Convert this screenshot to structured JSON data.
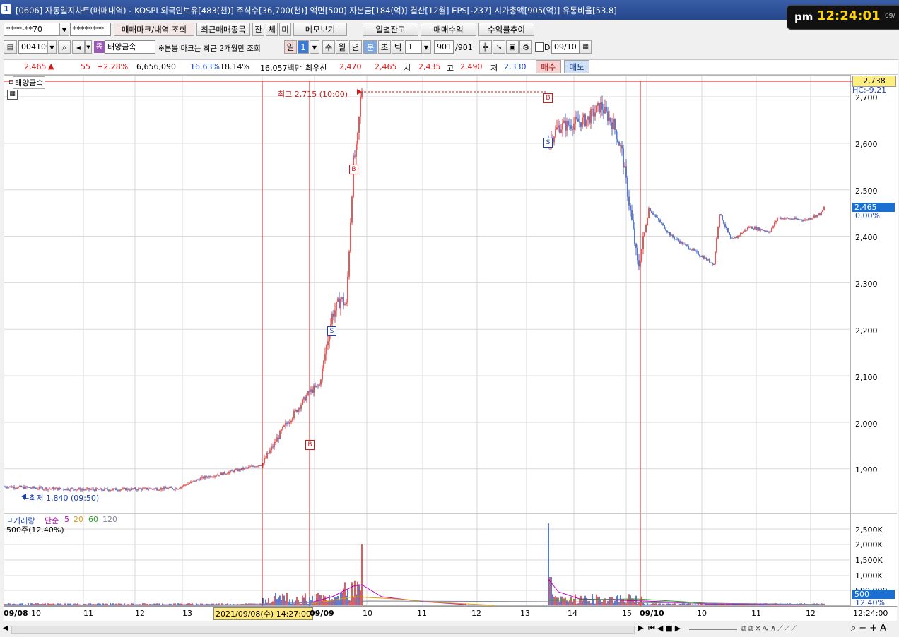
{
  "window": {
    "num": "1",
    "title": "[0606] 자동일지차트(매매내역) - KOSPI 외국인보유[483(천)] 주식수[36,700(천)] 액면[500] 자본금[184(억)] 결산[12월] EPS[-237] 시가총액[905(억)] 유통비율[53.8]"
  },
  "clock": {
    "ampm": "pm",
    "time": "12:24:01",
    "date": "09/"
  },
  "toolbar1": {
    "account": "****-**70",
    "password": "********",
    "mark_btn": "매매마크/내역 조회",
    "recent_btn": "최근매매종목",
    "b_jan": "잔",
    "b_che": "체",
    "b_mi": "미",
    "memo_btn": "메모보기",
    "daily_btn": "일별잔고",
    "profit_btn": "매매수익",
    "rate_btn": "수익률추이"
  },
  "toolbar2": {
    "code": "004100",
    "name_badge": "종",
    "name": "태양금속",
    "note": "※분봉 마크는 최근 2개월만 조회",
    "periods": [
      "일",
      "주",
      "월",
      "년",
      "분",
      "초",
      "틱"
    ],
    "period_num": "1",
    "tick_num": "1",
    "count": "901",
    "count_total": "/901",
    "checkbox_d": "D",
    "date": "09/10"
  },
  "quote": {
    "price": "2,465",
    "arrow": "▲",
    "change": "55",
    "pct": "+2.28%",
    "volume": "6,656,090",
    "vol_pct": "16.63%",
    "turnover": "18.14%",
    "amount": "16,057백만",
    "best_label": "최우선",
    "ask": "2,470",
    "bid": "2,465",
    "open_label": "시",
    "open": "2,435",
    "high_label": "고",
    "high": "2,490",
    "low_label": "저",
    "low": "2,330",
    "buy_btn": "매수",
    "sell_btn": "매도"
  },
  "chart": {
    "name": "태양금속",
    "high_label": "최고 2,715 (10:00)",
    "low_label": "←최저 1,840 (09:50)",
    "price_axis": [
      "2,700",
      "2,600",
      "2,500",
      "2,400",
      "2,300",
      "2,200",
      "2,100",
      "2,000",
      "1,900"
    ],
    "top_tag": "2,738",
    "hc_tag": "HC:-9.21",
    "cur_tag": "2,465",
    "zero_tag": "0.00%",
    "vol_title": "거래량",
    "vol_ma_label": "단순",
    "vol_ma": [
      "5",
      "20",
      "60",
      "120"
    ],
    "vol_sub": "500주(12.40%)",
    "vol_axis": [
      "2,500K",
      "2,000K",
      "1,500K",
      "1,000K",
      "500,000"
    ],
    "vol_tag": "500",
    "vol_pct_tag": "12.40%",
    "x_labels": {
      "d1": "09/08",
      "d1_10": "10",
      "d1_11": "11",
      "d1_12": "12",
      "d1_13": "13",
      "cursor": "2021/09/08(수) 14:27:00",
      "d2": "09/09",
      "d2_10": "10",
      "d2_11": "11",
      "d2_12": "12",
      "d2_13": "13",
      "d2_14": "14",
      "d2_15": "15",
      "d3": "09/10",
      "d3_10": "10",
      "d3_11": "11",
      "d3_12": "12",
      "now": "12:24:00"
    },
    "marks": {
      "b": "B",
      "s": "S"
    },
    "colors": {
      "up": "#d01818",
      "down": "#1a3fb8",
      "grid": "#d9d9d9",
      "ma5": "#c000c0",
      "ma20": "#e0a000",
      "ma60": "#20a020",
      "ma120": "#8080a0"
    }
  },
  "chart_data": {
    "type": "candlestick",
    "title": "태양금속",
    "x": [
      "09/08",
      "09/09",
      "09/10 12:24"
    ],
    "y": [
      1840,
      2715,
      2465
    ],
    "ylim": [
      1840,
      2738
    ],
    "high": 2715,
    "low": 1840,
    "last": 2465
  }
}
